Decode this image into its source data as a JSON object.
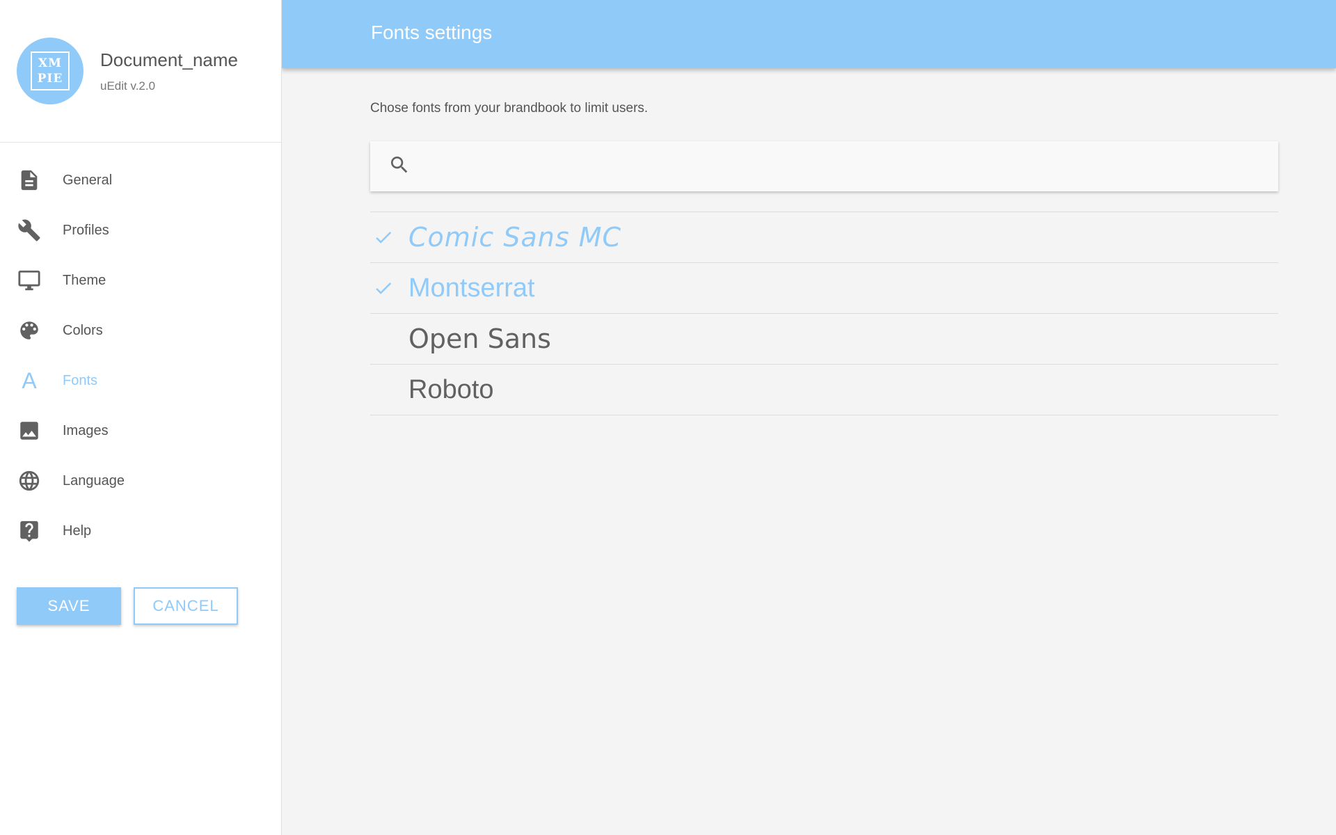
{
  "document": {
    "name": "Document_name",
    "version": "uEdit v.2.0",
    "logo_line1": "XM",
    "logo_line2": "PIE"
  },
  "sidebar": {
    "items": [
      {
        "label": "General",
        "icon": "document-icon"
      },
      {
        "label": "Profiles",
        "icon": "wrench-icon"
      },
      {
        "label": "Theme",
        "icon": "monitor-icon"
      },
      {
        "label": "Colors",
        "icon": "palette-icon"
      },
      {
        "label": "Fonts",
        "icon": "font-icon",
        "active": true
      },
      {
        "label": "Images",
        "icon": "image-icon"
      },
      {
        "label": "Language",
        "icon": "globe-icon"
      },
      {
        "label": "Help",
        "icon": "help-icon"
      }
    ],
    "font_icon_glyph": "A",
    "save_label": "SAVE",
    "cancel_label": "CANCEL"
  },
  "header": {
    "title": "Fonts settings"
  },
  "main": {
    "description": "Chose fonts from your brandbook to limit users.",
    "search": {
      "value": "",
      "placeholder": ""
    },
    "fonts": [
      {
        "name": "Comic Sans MC",
        "selected": true
      },
      {
        "name": "Montserrat",
        "selected": true
      },
      {
        "name": "Open Sans",
        "selected": false
      },
      {
        "name": "Roboto",
        "selected": false
      }
    ]
  },
  "colors": {
    "accent": "#90caf9",
    "text": "#555555",
    "background": "#f4f4f4"
  }
}
